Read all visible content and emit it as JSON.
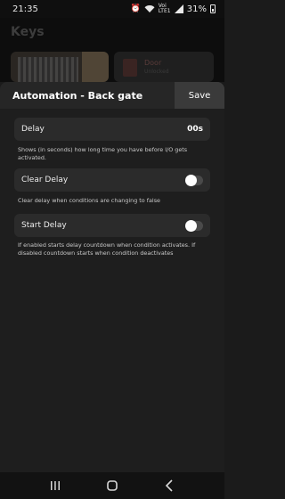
{
  "status": {
    "time": "21:35",
    "network": "Voi LTE1",
    "battery": "31%"
  },
  "background": {
    "title": "Keys",
    "card_name": "Door",
    "card_sub": "Unlocked"
  },
  "sheet": {
    "title": "Automation - Back gate",
    "save_label": "Save"
  },
  "delay": {
    "label": "Delay",
    "value": "00s",
    "help": "Shows (in seconds) how long time you have before I/O gets activated."
  },
  "clear_delay": {
    "label": "Clear Delay",
    "enabled": false,
    "help": "Clear delay when conditions are changing to false"
  },
  "start_delay": {
    "label": "Start Delay",
    "enabled": false,
    "help": "If enabled starts delay countdown when condition activates. If disabled countdown starts when condition deactivates"
  },
  "icons": [
    "wifi-icon",
    "alarm-icon",
    "signal-icon",
    "battery-icon",
    "recents-icon",
    "home-icon",
    "back-icon"
  ]
}
